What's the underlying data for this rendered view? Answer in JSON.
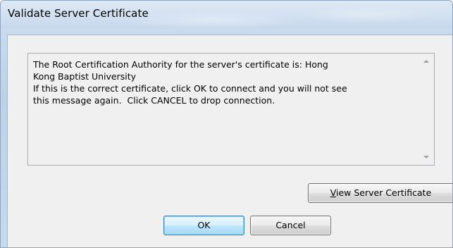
{
  "window": {
    "title": "Validate Server Certificate"
  },
  "message": {
    "text": "The Root Certification Authority for the server's certificate is: Hong\nKong Baptist University\nIf this is the correct certificate, click OK to connect and you will not see\nthis message again.  Click CANCEL to drop connection."
  },
  "buttons": {
    "view_certificate_mnemonic": "V",
    "view_certificate_rest": "iew Server Certificate",
    "ok": "OK",
    "cancel": "Cancel"
  },
  "icons": {
    "scroll_up": "scroll-up-arrow-icon",
    "scroll_down": "scroll-down-arrow-icon"
  },
  "colors": {
    "title_bar": "#c6d8ec",
    "dialog_background": "#f0f0f0",
    "default_button_border": "#3c7fb1"
  }
}
